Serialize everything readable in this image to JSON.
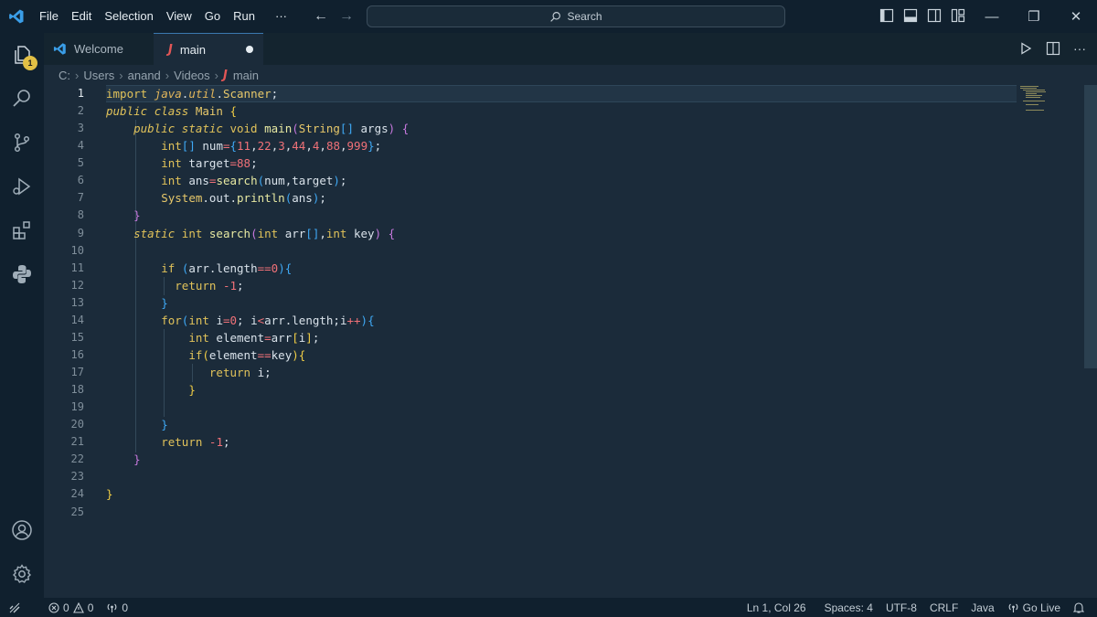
{
  "menu": {
    "file": "File",
    "edit": "Edit",
    "selection": "Selection",
    "view": "View",
    "go": "Go",
    "run": "Run",
    "more": "···"
  },
  "search": {
    "placeholder": "Search"
  },
  "activity": {
    "explorer_badge": "1"
  },
  "tabs": [
    {
      "label": "Welcome"
    },
    {
      "label": "main",
      "icon": "J"
    }
  ],
  "breadcrumb": [
    "C:",
    "Users",
    "anand",
    "Videos",
    "main"
  ],
  "breadcrumb_file_icon": "J",
  "editor": {
    "active_line": 1,
    "line_numbers": [
      "1",
      "2",
      "3",
      "4",
      "5",
      "6",
      "7",
      "8",
      "9",
      "10",
      "11",
      "12",
      "13",
      "14",
      "15",
      "16",
      "17",
      "18",
      "19",
      "20",
      "21",
      "22",
      "23",
      "24",
      "25"
    ],
    "lines": [
      "import java.util.Scanner;",
      "public class Main {",
      "    public static void main(String[] args) {",
      "        int[] num={11,22,3,44,4,88,999};",
      "        int target=88;",
      "        int ans=search(num,target);",
      "        System.out.println(ans);",
      "    }",
      "    static int search(int arr[],int key) {",
      "",
      "        if (arr.length==0){",
      "          return -1;",
      "        }",
      "        for(int i=0; i<arr.length;i++){",
      "            int element=arr[i];",
      "            if(element==key){",
      "               return i;",
      "            }",
      "",
      "        }",
      "        return -1;",
      "    }",
      "",
      "}",
      ""
    ]
  },
  "status": {
    "errors": "0",
    "warnings": "0",
    "ports": "0",
    "position": "Ln 1, Col 26",
    "spaces": "Spaces: 4",
    "encoding": "UTF-8",
    "eol": "CRLF",
    "language": "Java",
    "golive": "Go Live"
  },
  "colors": {
    "titlebar": "#10202e",
    "editor": "#1b2b3a",
    "keyword": "#e0c25a",
    "number": "#f07178",
    "badge": "#e2c045"
  }
}
